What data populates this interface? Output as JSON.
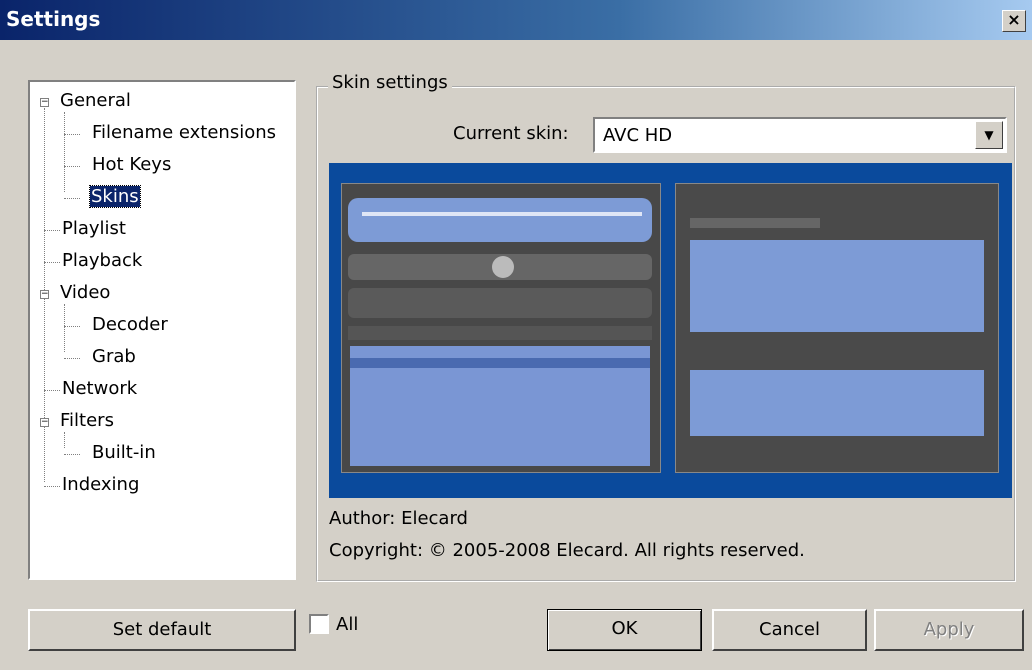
{
  "window": {
    "title": "Settings",
    "close_glyph": "×"
  },
  "tree": {
    "items": [
      {
        "label": "General",
        "expander": "−"
      },
      {
        "label": "Filename extensions"
      },
      {
        "label": "Hot Keys"
      },
      {
        "label": "Skins",
        "selected": true
      },
      {
        "label": "Playlist"
      },
      {
        "label": "Playback"
      },
      {
        "label": "Video",
        "expander": "−"
      },
      {
        "label": "Decoder"
      },
      {
        "label": "Grab"
      },
      {
        "label": "Network"
      },
      {
        "label": "Filters",
        "expander": "−"
      },
      {
        "label": "Built-in"
      },
      {
        "label": "Indexing"
      }
    ]
  },
  "skin_settings": {
    "group_label": "Skin settings",
    "current_skin_label": "Current skin:",
    "current_skin_value": "AVC HD",
    "dropdown_icon": "▼",
    "author": "Author: Elecard",
    "copyright": "Copyright: © 2005-2008 Elecard. All rights reserved."
  },
  "buttons": {
    "set_default": "Set default",
    "all_label": "All",
    "ok": "OK",
    "cancel": "Cancel",
    "apply": "Apply"
  },
  "colors": {
    "title_bar": "#0a246a",
    "preview_bg": "#0a4a9c",
    "selection": "#0a246a"
  }
}
